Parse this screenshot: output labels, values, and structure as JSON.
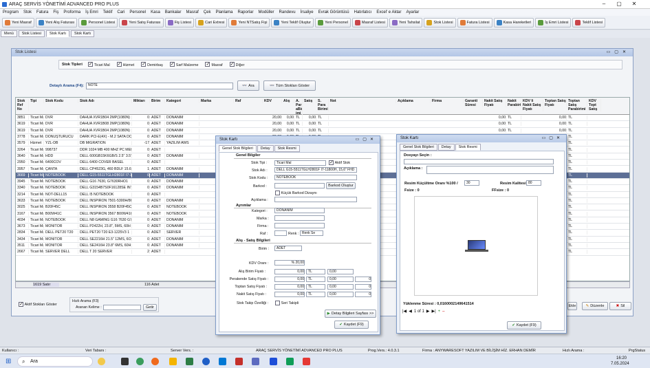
{
  "app": {
    "title": "ARAÇ SERVİS YÖNETİMİ ADVANCED PRO PLUS"
  },
  "menu": [
    "Program",
    "Stok",
    "Fatura",
    "Fiş",
    "Proforma",
    "İş Emri",
    "Teklif",
    "Cari",
    "Personel",
    "Kasa",
    "Bankalar",
    "Masraf",
    "Çek",
    "Planlama",
    "Raporlar",
    "Modüller",
    "Randevu",
    "İrsaliye",
    "Evrak Görüntüsü",
    "Hatırlatıcı",
    "Excel' e Aktar",
    "Ayarlar"
  ],
  "toolbar": [
    "Yeni Masraf",
    "Yeni Alış Faturası",
    "Personel Listesi",
    "Yeni Satış Faturası",
    "Fiş Listesi",
    "Cari Extresi",
    "Yeni NTSatış Fişi",
    "Yeni Teklif Oluştur",
    "Yeni Personel",
    "Masraf Listesi",
    "Yeni Tahsilat",
    "Stok Listesi",
    "Fatura Listesi",
    "Kasa Hareketleri",
    "İş Emri Listesi",
    "Teklif Listesi"
  ],
  "tabs": [
    "Menü",
    "Stok Listesi",
    "Stok Kartı",
    "Stok Kartı"
  ],
  "stok_list": {
    "title": "Stok Listesi",
    "types_label": "Stok Tipleri",
    "types": [
      "Ticari Mal",
      "Hizmet",
      "Demirbaş",
      "Sarf Malzeme",
      "Masraf",
      "Diğer"
    ],
    "search_label": "Detaylı Arama (F4):",
    "search_value": "NOTE",
    "search_btn": "Ara",
    "all_btn": "Tüm Stokları Göster",
    "columns": [
      "Stok Ref No",
      "Tipi",
      "Stok Kodu",
      "Stok Adı",
      "Miktarı",
      "Birim",
      "Kategori",
      "Marka",
      "Raf",
      "KDV",
      "Alış",
      "A. Par aBir imi",
      "Satış",
      "S. Para Birimi",
      "Not",
      "Açıklama",
      "Firma",
      "Garanti Süresi",
      "Nakit Satış Fiyatı",
      "Nakit Parabirimi",
      "KDV li Nakit Satış Fiyatı",
      "Toptan Satış Fiyatı",
      "Toptan Satış Parabirimi",
      "KDV Topt Satış"
    ],
    "rows": [
      [
        "3851",
        "Ticari Mal",
        "DVR",
        "DAHUA XVR1B04 2MP(1080N)",
        "0",
        "ADET",
        "DONANIM",
        "",
        "",
        "20,00",
        "0,00",
        "TL",
        "0,00",
        "TL",
        "",
        "",
        "",
        "",
        "0,00",
        "TL",
        "",
        "0,00",
        "TL",
        ""
      ],
      [
        "3619",
        "Ticari Mal",
        "DVR",
        "DAHUA XVR1B08 2MP(1080N)",
        "0",
        "ADET",
        "DONANIM",
        "",
        "",
        "20,00",
        "0,00",
        "TL",
        "0,00",
        "TL",
        "",
        "",
        "",
        "",
        "0,00",
        "TL",
        "",
        "0,00",
        "TL",
        ""
      ],
      [
        "3619",
        "Ticari Mal",
        "DVR",
        "DAHUA XVR1B04 2MP(1080N)",
        "0",
        "ADET",
        "DONANIM",
        "",
        "",
        "20,00",
        "0,00",
        "TL",
        "0,00",
        "TL",
        "",
        "",
        "",
        "",
        "0,00",
        "TL",
        "",
        "0,00",
        "TL",
        ""
      ],
      [
        "3778",
        "Ticari Mal",
        "DÖNÜŞTÜRÜCÜ",
        "DARK PCI-E(4X) - M.2 SATA DÖ",
        "0",
        "ADET",
        "DONANIM",
        "",
        "",
        "20,00",
        "0,00",
        "TL",
        "0,00",
        "TL",
        "",
        "",
        "",
        "",
        "0,00",
        "TL",
        "",
        "0,00",
        "TL",
        ""
      ],
      [
        "3579",
        "Hizmet",
        "YZL-DB",
        "DB MIGRATION",
        "-17",
        "ADET",
        "YAZILIM AWS",
        "",
        "",
        "20,00",
        "0,00",
        "TL",
        "0,00",
        "TL",
        "",
        "",
        "",
        "",
        "0,00",
        "TL",
        "",
        "0,00",
        "TL",
        ""
      ],
      [
        "3264",
        "Ticari Mal",
        "998737",
        "DDR 1024 MB 400 MHZ PC MEMORY",
        "0",
        "ADET",
        "",
        "",
        "",
        "",
        "",
        "",
        "",
        "",
        "",
        "",
        "",
        "",
        "0,00",
        "TL",
        "",
        "0,00",
        "TL",
        ""
      ],
      [
        "3640",
        "Ticari Mal",
        "HDD",
        "DELL 600GB15K6GB/S 2.5\" 3.5\"",
        "0",
        "ADET",
        "DONANIM",
        "",
        "",
        "",
        "",
        "",
        "",
        "",
        "",
        "",
        "",
        "",
        "0,00",
        "TL",
        "",
        "0,00",
        "TL",
        ""
      ],
      [
        "2950",
        "Ticari Mal",
        "6400COV",
        "DELL 6400 COVER BASEL",
        "0",
        "ADET",
        "",
        "",
        "",
        "",
        "",
        "",
        "",
        "",
        "",
        "",
        "",
        "",
        "0,00",
        "TL",
        "",
        "0,00",
        "TL",
        ""
      ],
      [
        "3957",
        "Ticari Mal",
        "ÇANTA",
        "DELL CP4523G, 460 BDLF 15.6\"",
        "1",
        "ADET",
        "DONANIM",
        "",
        "",
        "",
        "",
        "",
        "",
        "",
        "",
        "",
        "",
        "",
        "0,00",
        "TL",
        "",
        "0,00",
        "TL",
        ""
      ],
      [
        "3669",
        "Ticari Mal",
        "NOTEBOOK",
        "DELL G15-5511TGLH2801F I7-11800H",
        "0",
        "ADET",
        "DONANIM",
        "",
        "",
        "",
        "",
        "",
        "",
        "",
        "",
        "",
        "",
        "",
        "0,00",
        "TL",
        "",
        "0,00",
        "TL",
        ""
      ],
      [
        "3945",
        "Ticari Mal",
        "NOTEBOOK",
        "DELL G16 7630, G7630RHO1",
        "0",
        "ADET",
        "DONANIM",
        "",
        "",
        "",
        "",
        "",
        "",
        "",
        "",
        "",
        "",
        "",
        "0,00",
        "TL",
        "",
        "0,00",
        "TL",
        ""
      ],
      [
        "3340",
        "Ticari Mal",
        "NOTEBOOK",
        "DELL G3154B7S0F16128SE INTEL",
        "0",
        "ADET",
        "DONANIM",
        "",
        "",
        "",
        "",
        "",
        "",
        "",
        "",
        "",
        "",
        "",
        "0,00",
        "TL",
        "",
        "0,00",
        "TL",
        ""
      ],
      [
        "3214",
        "Ticari Mal",
        "NOT-DELL15",
        "DELL I5 NOTEBOOK",
        "0",
        "ADET",
        "",
        "",
        "",
        "",
        "",
        "",
        "",
        "",
        "",
        "",
        "",
        "",
        "0,00",
        "TL",
        "",
        "0,00",
        "TL",
        ""
      ],
      [
        "3633",
        "Ticari Mal",
        "NOTEBOOK",
        "DELL INSPIRON 7501-5300H/8GB",
        "0",
        "ADET",
        "DONANIM",
        "",
        "",
        "",
        "",
        "",
        "",
        "",
        "",
        "",
        "",
        "",
        "0,00",
        "TL",
        "",
        "0,00",
        "TL",
        ""
      ],
      [
        "3025",
        "Ticari Mal",
        "B20F45C",
        "DELL INSPIRON 3558 B20F45C",
        "0",
        "ADET",
        "NOTEBOOK",
        "",
        "",
        "",
        "",
        "",
        "",
        "",
        "",
        "",
        "",
        "",
        "0,00",
        "TL",
        "",
        "0,00",
        "TL",
        ""
      ],
      [
        "3167",
        "Ticari Mal",
        "B00W41C",
        "DELL INSPIRON 3567 B00W41C",
        "0",
        "ADET",
        "NOTEBOOK",
        "",
        "",
        "",
        "",
        "",
        "",
        "",
        "",
        "",
        "",
        "",
        "0,00",
        "TL",
        "",
        "0,00",
        "TL",
        ""
      ],
      [
        "4034",
        "Ticari Mal",
        "NOTEBOOK",
        "DELL N8 GAMING G16 7630 G76",
        "0",
        "ADET",
        "DONANIM",
        "",
        "",
        "",
        "",
        "",
        "",
        "",
        "",
        "",
        "",
        "",
        "0,00",
        "TL",
        "",
        "0,00",
        "TL",
        ""
      ],
      [
        "3673",
        "Ticari Mal",
        "MONİTÖR",
        "DELL P2422H, 23.8\", 5MS, 60H",
        "0",
        "ADET",
        "DONANIM",
        "",
        "",
        "",
        "",
        "",
        "",
        "",
        "",
        "",
        "",
        "",
        "0,00",
        "TL",
        "",
        "0,00",
        "TL",
        ""
      ],
      [
        "2834",
        "Ticari Mal",
        "DELL PET20 T20",
        "DELL PET20 T20 E3-1225V3 1",
        "0",
        "ADET",
        "SERVER",
        "",
        "",
        "",
        "",
        "",
        "",
        "",
        "",
        "",
        "",
        "",
        "0,00",
        "TL",
        "",
        "0,00",
        "TL",
        ""
      ],
      [
        "3434",
        "Ticari Mal",
        "MONİTÖR",
        "DELL SE2216H 21.5\" 12MS, 6ONIT",
        "0",
        "ADET",
        "DONANIM",
        "",
        "",
        "",
        "",
        "",
        "",
        "",
        "",
        "",
        "",
        "",
        "0,00",
        "TL",
        "",
        "0,00",
        "TL",
        ""
      ],
      [
        "3511",
        "Ticari Mal",
        "MONİTÖR",
        "DELL SE2416H 23.8\" 6MS, 60H",
        "0",
        "ADET",
        "DONANIM",
        "",
        "",
        "",
        "",
        "",
        "",
        "",
        "",
        "",
        "",
        "",
        "0,00",
        "TL",
        "",
        "0,00",
        "TL",
        ""
      ],
      [
        "2667",
        "Ticari Mal",
        "SERVER DELL",
        "DELL T 20 SERVER",
        "2",
        "ADET",
        "",
        "",
        "",
        "",
        "",
        "",
        "",
        "",
        "",
        "",
        "",
        "",
        "0,00",
        "TL",
        "",
        "0,00",
        "TL",
        ""
      ]
    ],
    "row_count": "1619 Satır",
    "qty_total": "116 Adet",
    "passive_label": "Aktif Stokları Göster",
    "quick_search_label": "Hızlı Arama (F3)",
    "search_word_label": "Aranan Kelime :",
    "search_go": "Getir",
    "side_buttons": {
      "ekle": "Ekle",
      "duzenle": "Düzenle",
      "sil": "Sil"
    }
  },
  "stok_kart1": {
    "title": "Stok Kartı",
    "tabs": [
      "Genel Stok Bilgileri",
      "Detay",
      "Stok Resmi"
    ],
    "sec_general": "Genel Bilgiler",
    "stok_tipi_label": "Stok Tipi :",
    "stok_tipi": "Ticari Mal",
    "aktif": "Aktif Stok",
    "stok_adi_label": "Stok Adı :",
    "stok_adi": "DELL G15-5511TGLH2801F I7-11800H, 15,6\" FHD",
    "stok_kodu_label": "Stok Kodu :",
    "stok_kodu": "NOTEBOOK",
    "barkod_label": "Barkod :",
    "barkod_btn": "Barkod Oluştur",
    "kucuk_barkod": "Küçük Barkod Dizaynı",
    "aciklama_label": "Açıklama :",
    "sec_ayrim": "Ayrımlar",
    "kategori_label": "Kategori :",
    "kategori": "DONANIM",
    "marka_label": "Marka :",
    "firma_label": "Firma :",
    "raf_label": "Raf :",
    "renk_label": "Renk :",
    "renk_value": "Renk Se",
    "sec_alis": "Alış - Satış Bilgileri",
    "birim_label": "Birim :",
    "birim": "ADET",
    "kdv_label": "KDV Oranı :",
    "kdv": "% 20,00",
    "prices": [
      {
        "label": "Alış Birim Fiyatı :",
        "value": "0,00",
        "cur": "TL",
        "extra": "0,00",
        "extra2": ""
      },
      {
        "label": "Perakende Satış Fiyatı :",
        "value": "0,00",
        "cur": "TL",
        "extra": "0,00",
        "extra2": "0"
      },
      {
        "label": "Toptan Satış Fiyatı :",
        "value": "0,00",
        "cur": "TL",
        "extra": "0,00",
        "extra2": "0"
      },
      {
        "label": "Nakit Satış Fiyatı :",
        "value": "0,00",
        "cur": "TL",
        "extra": "0,00",
        "extra2": "0"
      }
    ],
    "takip_label": "Stok Takip Özelliği :",
    "seri": "Seri Takipli",
    "detay_btn": "Detay Bilgileri Sayfası >>",
    "save": "Kaydet (F9)"
  },
  "stok_kart2": {
    "title": "Stok Kartı",
    "tabs": [
      "Genel Stok Bilgileri",
      "Detay",
      "Stok Resmi"
    ],
    "dosya_label": "Dosyayı Seçin :",
    "aciklama_label": "Açıklama :",
    "kucultme_label": "Resim Küçültme Oranı %100 /",
    "kucultme": "30",
    "kalite_label": "Resim Kalitesi",
    "kalite": "80",
    "fsize_label": "Fsize :",
    "fsize": "0",
    "ffsize_label": "FFsize :",
    "ffsize": "0",
    "load_label": "Yüklenme Süresi : 0,0160002149641514",
    "page": "1 of 1",
    "save": "Kaydet (F9)"
  },
  "status": {
    "user_label": "Kullanıcı :",
    "db_label": "Veri Tabanı :",
    "server_label": "Server Vers. :",
    "center": "ARAÇ SERVİS YÖNETİMİ ADVANCED PRO PLUS",
    "prog": "Prog.Vers.: 4.0.3.1",
    "firma": "Firma : ANYWARESOFT YAZILIM VE BİLİŞİM HİZ. ERHAN DEMİR",
    "quick": "Hızlı Arama :",
    "progstat": "PrgStatus"
  },
  "taskbar": {
    "search": "Ara",
    "time": "16:20",
    "date": "7.05.2024"
  },
  "colors": {
    "accent": "#5d6f96",
    "dialog_head": "#c4d4ee"
  }
}
